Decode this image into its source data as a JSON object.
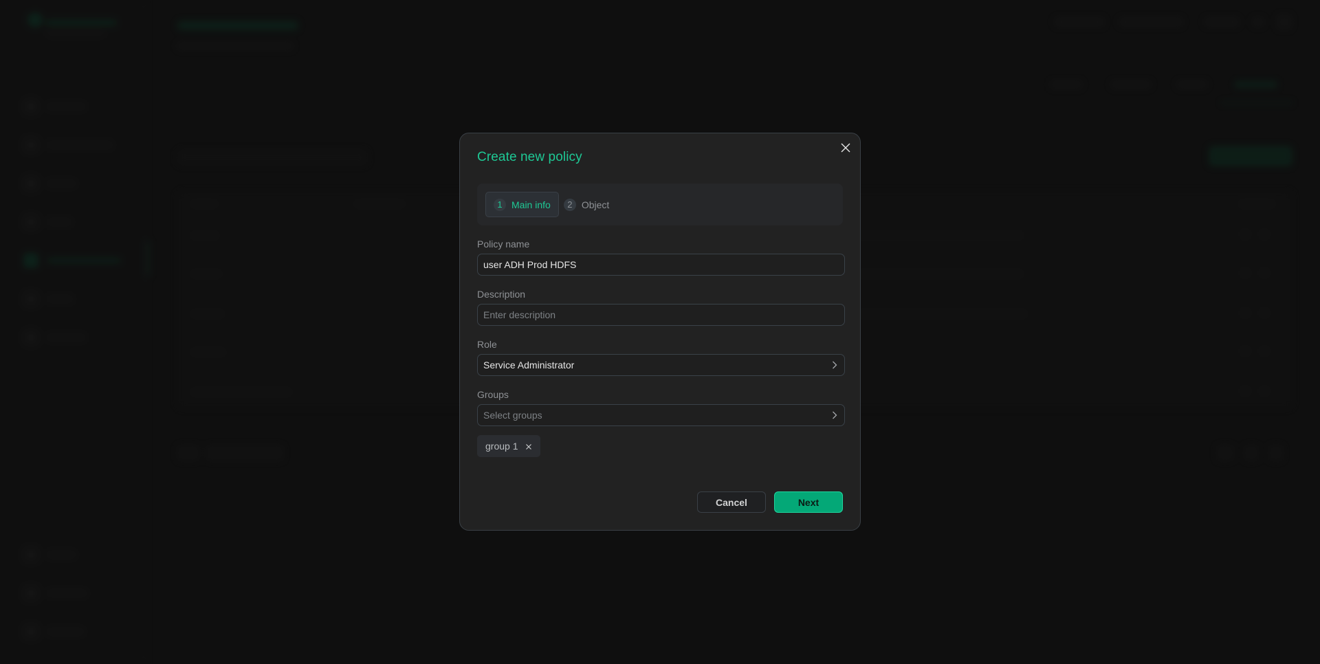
{
  "modal": {
    "title": "Create new policy",
    "close_icon": "close-icon",
    "steps": [
      {
        "number": "1",
        "label": "Main info",
        "active": true
      },
      {
        "number": "2",
        "label": "Object",
        "active": false
      }
    ],
    "fields": {
      "policy_name": {
        "label": "Policy name",
        "value": "user ADH Prod HDFS",
        "placeholder": ""
      },
      "description": {
        "label": "Description",
        "value": "",
        "placeholder": "Enter description"
      },
      "role": {
        "label": "Role",
        "value": "Service Administrator",
        "icon": "chevron-right-icon"
      },
      "groups": {
        "label": "Groups",
        "placeholder": "Select groups",
        "icon": "chevron-right-icon"
      }
    },
    "selected_groups": [
      {
        "label": "group 1",
        "remove_icon": "close-icon"
      }
    ],
    "buttons": {
      "cancel": "Cancel",
      "next": "Next"
    }
  },
  "theme": {
    "accent": "#1ec995",
    "primary_button": "#04a877",
    "modal_background": "#222222",
    "page_background": "#121212"
  }
}
